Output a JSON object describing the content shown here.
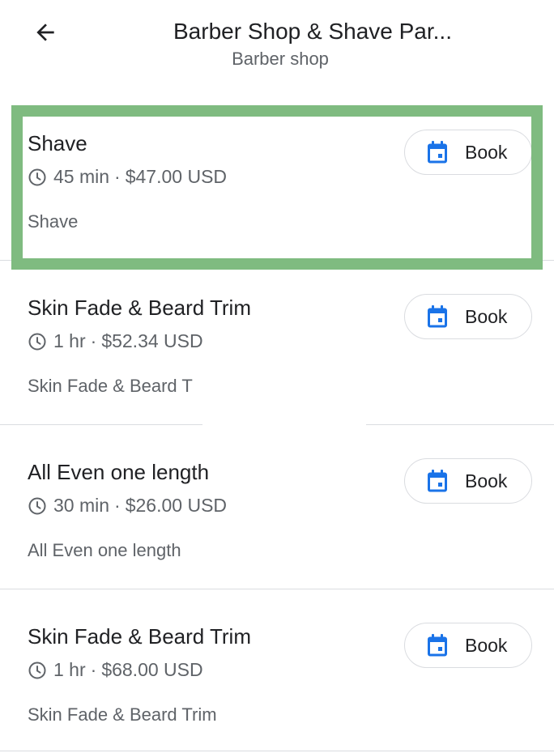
{
  "header": {
    "title": "Barber Shop & Shave Par...",
    "subtitle": "Barber shop",
    "back_icon": "arrow-left-icon"
  },
  "colors": {
    "accent": "#1a73e8",
    "highlight": "#7fbb80",
    "divider": "#dadce0",
    "secondary_text": "#5f6368"
  },
  "services": [
    {
      "name": "Shave",
      "duration": "45 min",
      "separator": "·",
      "price": "$47.00 USD",
      "description": "Shave",
      "book_label": "Book"
    },
    {
      "name": "Skin Fade & Beard Trim",
      "duration": "1 hr",
      "separator": "·",
      "price": "$52.34 USD",
      "description": "Skin Fade & Beard T",
      "book_label": "Book"
    },
    {
      "name": "All Even one length",
      "duration": "30 min",
      "separator": "·",
      "price": "$26.00 USD",
      "description": "All Even one length",
      "book_label": "Book"
    },
    {
      "name": "Skin Fade & Beard Trim",
      "duration": "1 hr",
      "separator": "·",
      "price": "$68.00 USD",
      "description": "Skin Fade & Beard Trim",
      "book_label": "Book"
    }
  ]
}
